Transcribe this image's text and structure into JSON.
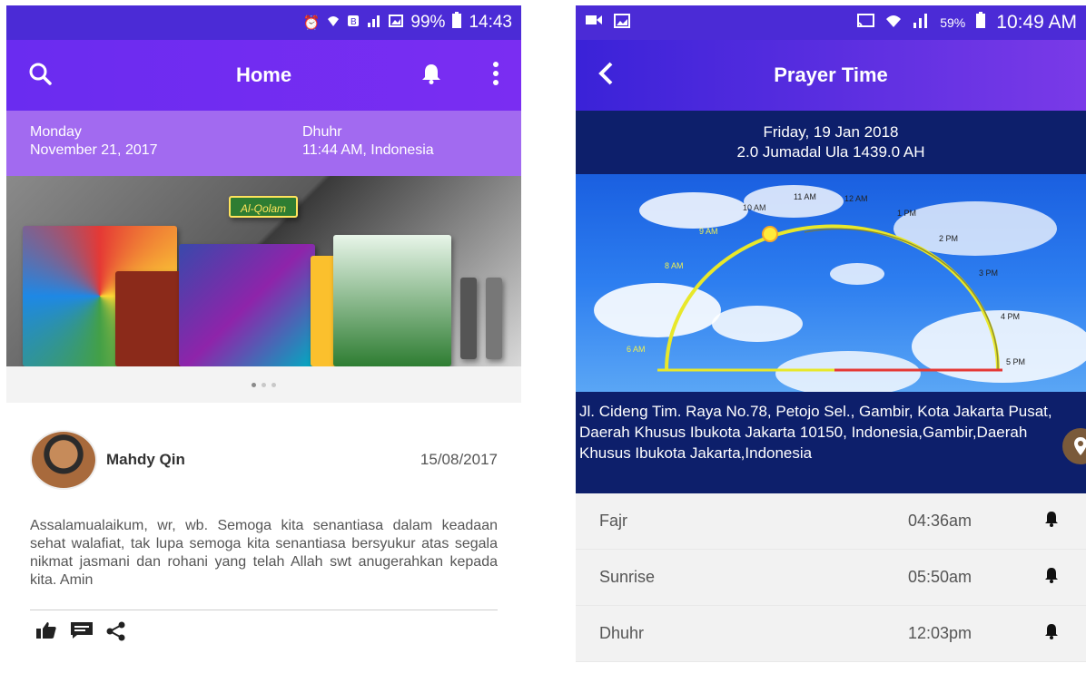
{
  "left": {
    "statusbar": {
      "icons": [
        "alarm-icon",
        "wifi-icon",
        "data-icon",
        "signal-icon",
        "image-icon"
      ],
      "battery": "99%",
      "time": "14:43"
    },
    "appbar": {
      "title": "Home"
    },
    "info": {
      "day": "Monday",
      "date": "November 21, 2017",
      "prayer_name": "Dhuhr",
      "prayer_time": "11:44 AM, Indonesia"
    },
    "banner": {
      "logo": "Al-Qolam",
      "slide_count": 3,
      "active_slide": 1
    },
    "post": {
      "author": "Mahdy Qin",
      "date": "15/08/2017",
      "body": "Assalamualaikum, wr, wb. Semoga kita senantiasa dalam keadaan sehat walafiat, tak lupa semoga kita senantiasa bersyukur atas segala nikmat jasmani dan rohani yang telah Allah swt anugerahkan kepada kita. Amin",
      "actions": [
        "like-icon",
        "comment-icon",
        "share-icon"
      ]
    }
  },
  "right": {
    "statusbar": {
      "battery": "59%",
      "time": "10:49 AM"
    },
    "appbar": {
      "title": "Prayer Time"
    },
    "date": {
      "gregorian": "Friday, 19 Jan 2018",
      "hijri": "2.0 Jumadal Ula 1439.0 AH"
    },
    "sun_path": {
      "labels": [
        "6 AM",
        "8 AM",
        "9 AM",
        "10 AM",
        "11 AM",
        "12 AM",
        "1 PM",
        "2 PM",
        "3 PM",
        "4 PM",
        "5 PM"
      ],
      "current": "10 AM"
    },
    "address": "Jl. Cideng Tim. Raya No.78, Petojo Sel., Gambir, Kota Jakarta Pusat, Daerah Khusus Ibukota Jakarta 10150, Indonesia,Gambir,Daerah Khusus Ibukota Jakarta,Indonesia",
    "prayers": [
      {
        "name": "Fajr",
        "time": "04:36am"
      },
      {
        "name": "Sunrise",
        "time": "05:50am"
      },
      {
        "name": "Dhuhr",
        "time": "12:03pm"
      }
    ]
  }
}
